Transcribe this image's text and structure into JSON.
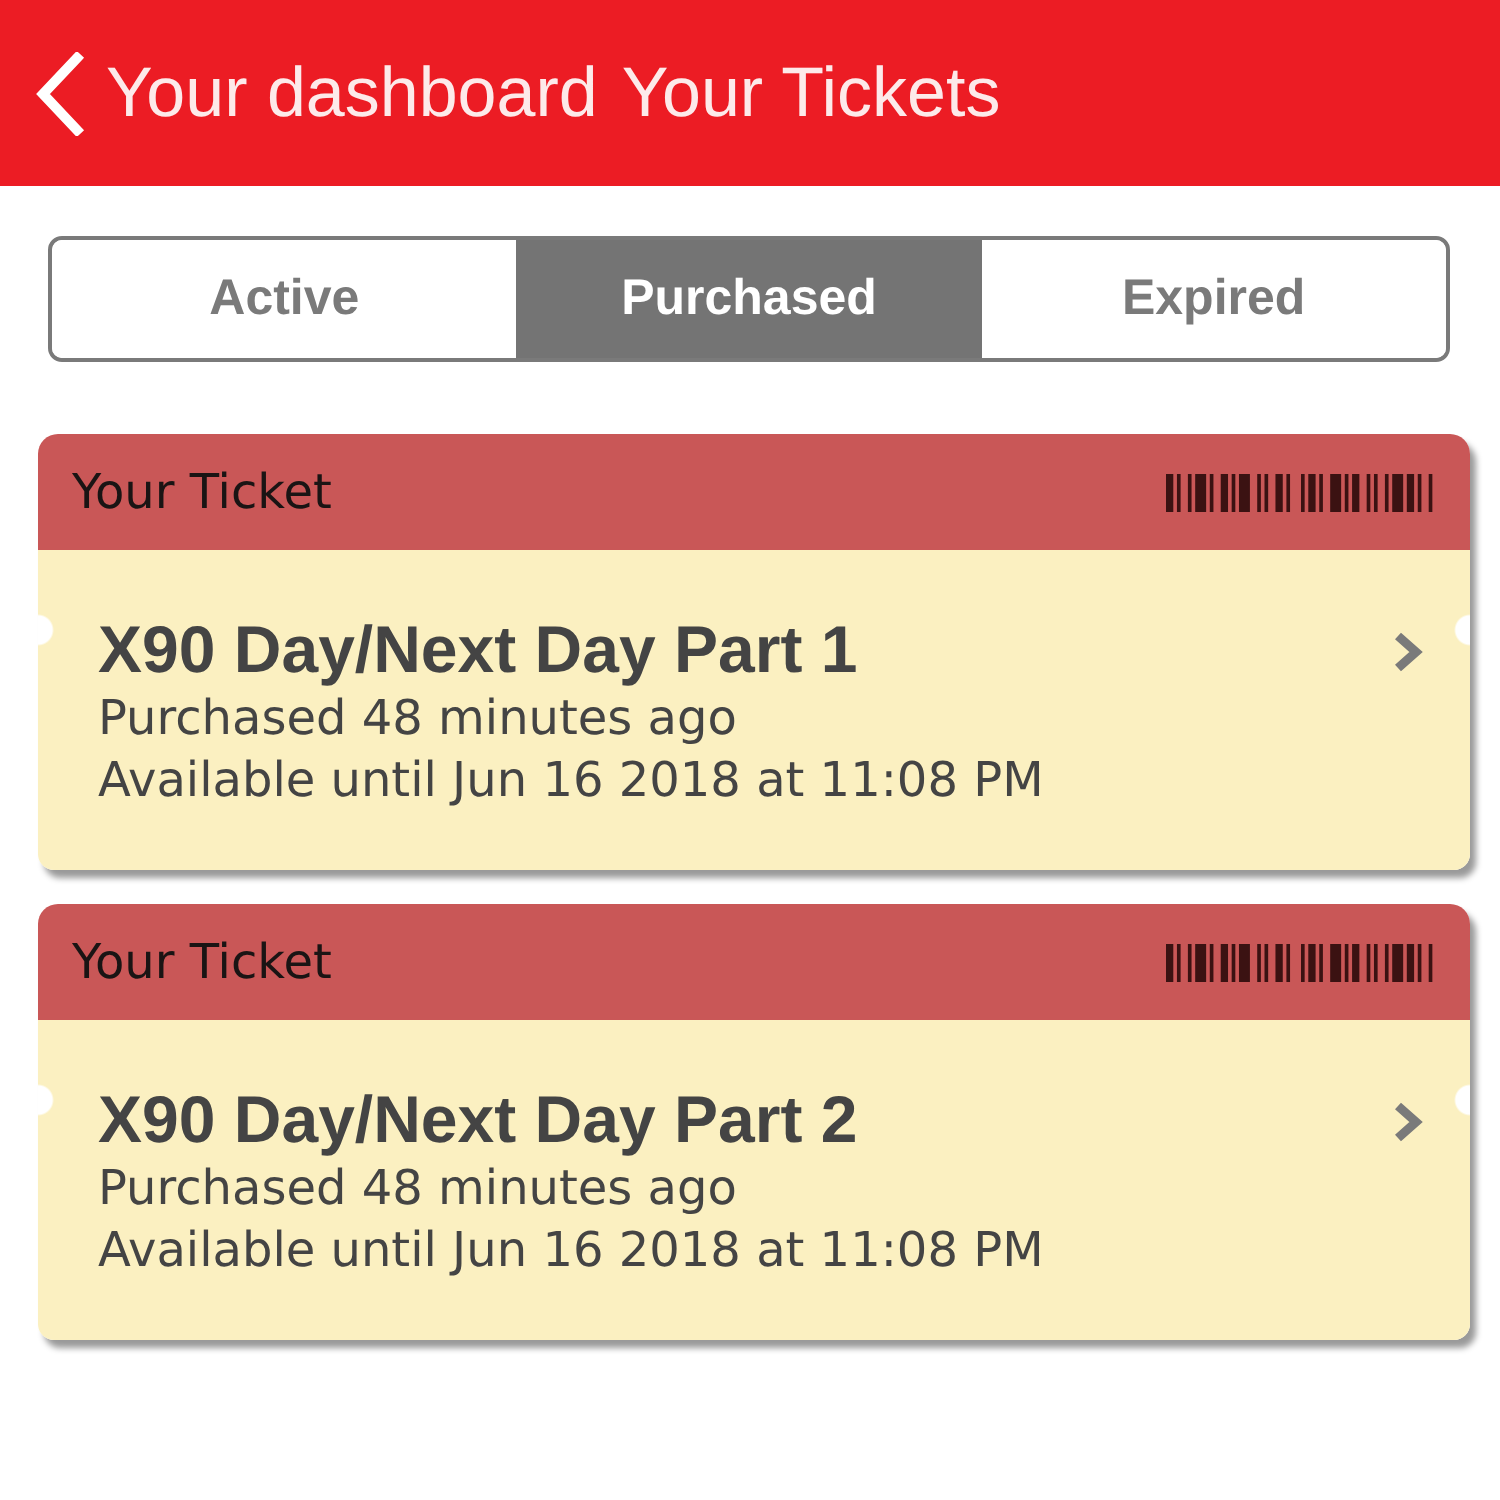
{
  "nav_bar": {
    "back_label": "Your dashboard",
    "title": "Your Tickets"
  },
  "tabs": [
    {
      "label": "Active",
      "selected": false
    },
    {
      "label": "Purchased",
      "selected": true
    },
    {
      "label": "Expired",
      "selected": false
    }
  ],
  "tickets": [
    {
      "header": "Your Ticket",
      "name": "X90 Day/Next Day Part 1",
      "purchased": "Purchased 48 minutes ago",
      "available": "Available until Jun 16 2018 at 11:08 PM"
    },
    {
      "header": "Your Ticket",
      "name": "X90 Day/Next Day Part 2",
      "purchased": "Purchased 48 minutes ago",
      "available": "Available until Jun 16 2018 at 11:08 PM"
    }
  ]
}
